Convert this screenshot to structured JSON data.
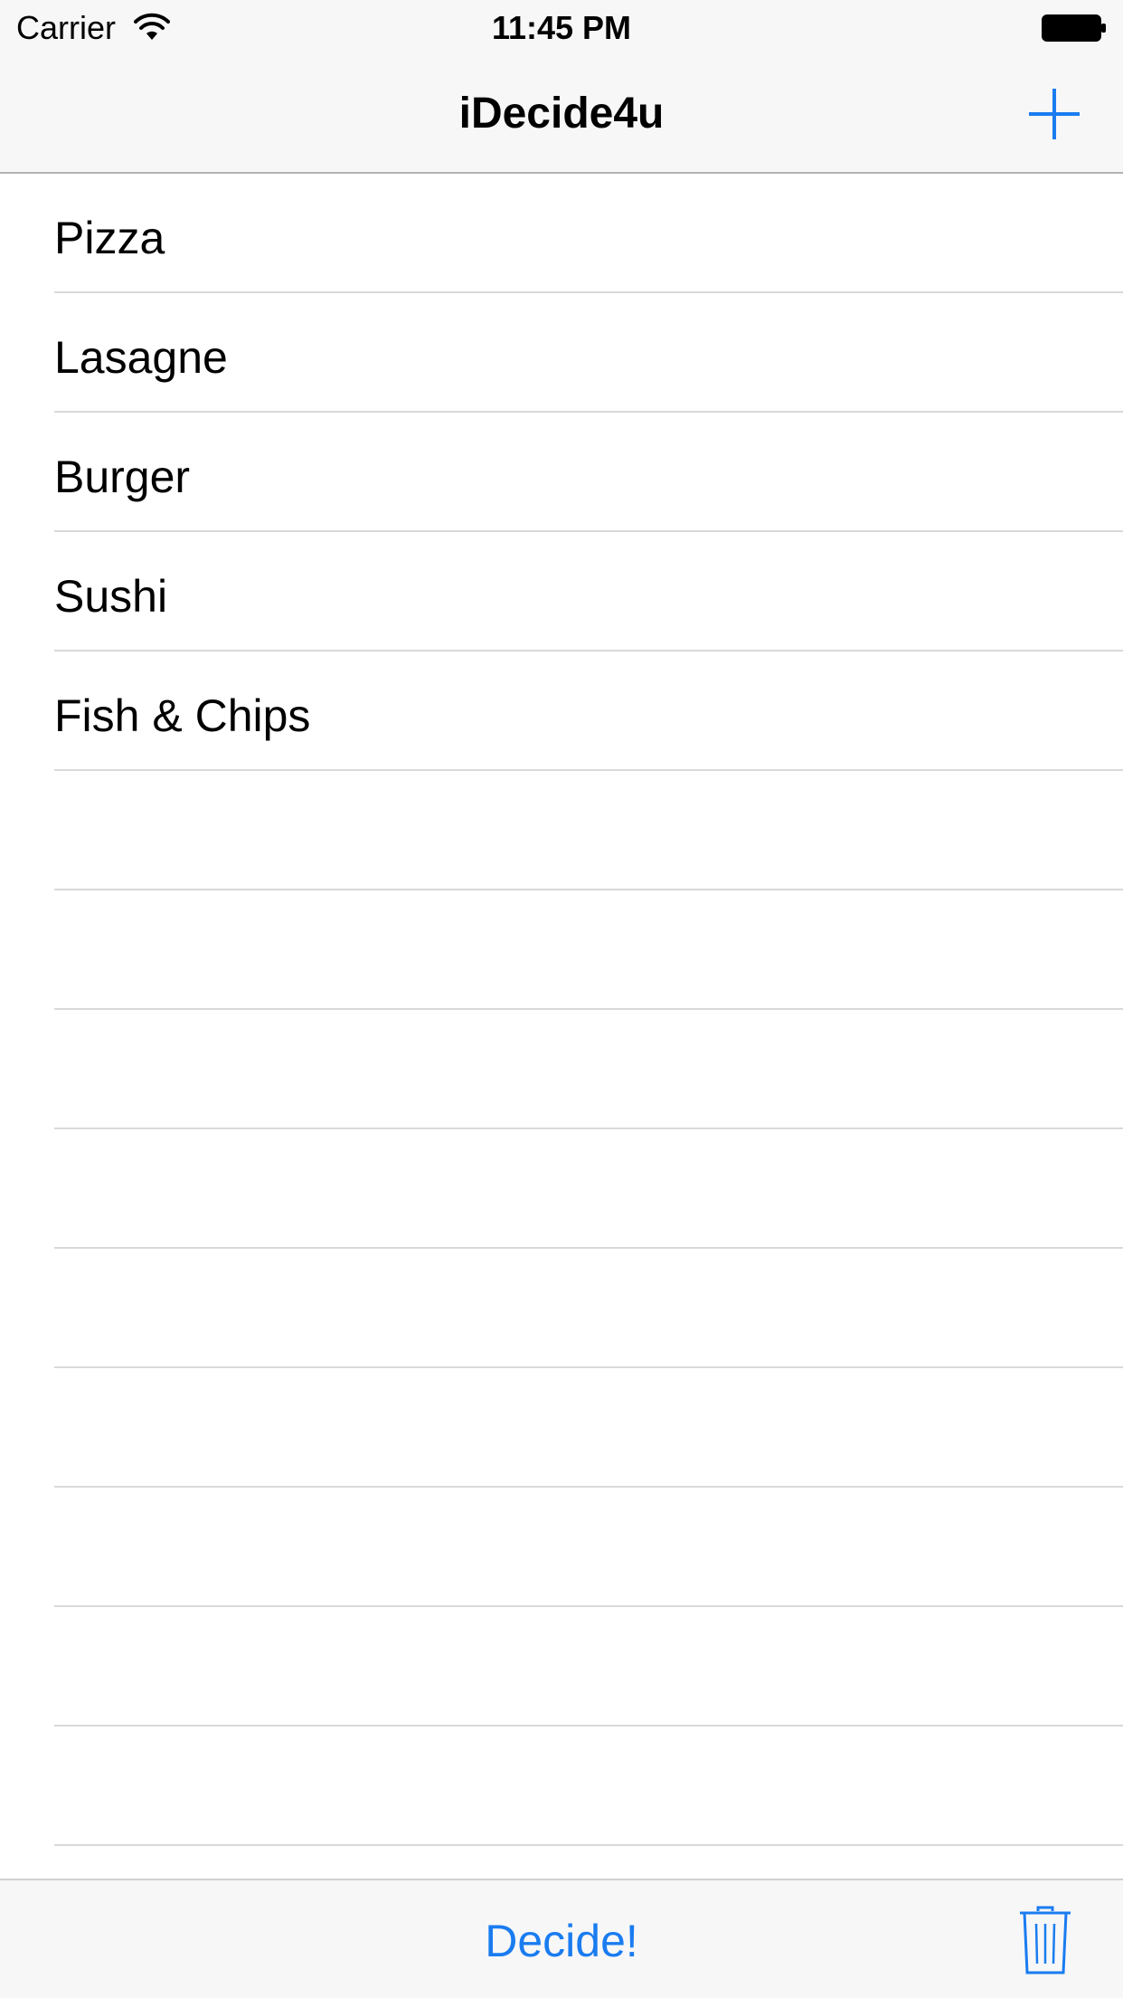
{
  "status_bar": {
    "carrier": "Carrier",
    "time": "11:45 PM",
    "icons": [
      "wifi-icon",
      "battery-icon"
    ]
  },
  "nav_bar": {
    "title": "iDecide4u",
    "add_icon": "plus-icon"
  },
  "table": {
    "items": [
      {
        "label": "Pizza"
      },
      {
        "label": "Lasagne"
      },
      {
        "label": "Burger"
      },
      {
        "label": "Sushi"
      },
      {
        "label": "Fish & Chips"
      },
      {
        "label": ""
      },
      {
        "label": ""
      },
      {
        "label": ""
      },
      {
        "label": ""
      },
      {
        "label": ""
      },
      {
        "label": ""
      },
      {
        "label": ""
      },
      {
        "label": ""
      },
      {
        "label": ""
      }
    ]
  },
  "toolbar": {
    "decide_label": "Decide!",
    "trash_icon": "trash-icon"
  },
  "colors": {
    "accent": "#1a7cf0",
    "bar_background": "#f7f7f7",
    "separator": "#d9d9d9"
  }
}
